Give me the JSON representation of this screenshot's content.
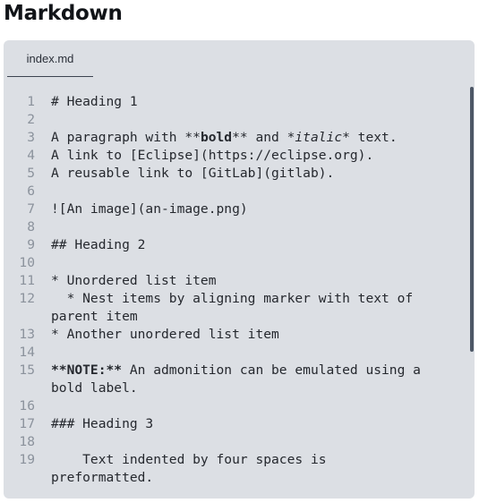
{
  "page": {
    "title": "Markdown"
  },
  "editor": {
    "tab_label": "index.md",
    "lines": [
      {
        "num": "1",
        "text": "# Heading 1"
      },
      {
        "num": "2",
        "text": ""
      },
      {
        "num": "3",
        "parts": [
          {
            "t": "A paragraph with **"
          },
          {
            "t": "bold",
            "style": "bold"
          },
          {
            "t": "** and *"
          },
          {
            "t": "italic",
            "style": "italic"
          },
          {
            "t": "* text."
          }
        ]
      },
      {
        "num": "4",
        "text": "A link to [Eclipse](https://eclipse.org)."
      },
      {
        "num": "5",
        "text": "A reusable link to [GitLab](gitlab)."
      },
      {
        "num": "6",
        "text": ""
      },
      {
        "num": "7",
        "text": "![An image](an-image.png)"
      },
      {
        "num": "8",
        "text": ""
      },
      {
        "num": "9",
        "text": "## Heading 2"
      },
      {
        "num": "10",
        "text": ""
      },
      {
        "num": "11",
        "text": "* Unordered list item"
      },
      {
        "num": "12",
        "text": "  * Nest items by aligning marker with text of"
      },
      {
        "num": "",
        "text": "parent item"
      },
      {
        "num": "13",
        "text": "* Another unordered list item"
      },
      {
        "num": "14",
        "text": ""
      },
      {
        "num": "15",
        "parts": [
          {
            "t": "**NOTE:**",
            "style": "bold"
          },
          {
            "t": " An admonition can be emulated using a"
          }
        ]
      },
      {
        "num": "",
        "text": "bold label."
      },
      {
        "num": "16",
        "text": ""
      },
      {
        "num": "17",
        "text": "### Heading 3"
      },
      {
        "num": "18",
        "text": ""
      },
      {
        "num": "19",
        "text": "    Text indented by four spaces is"
      },
      {
        "num": "",
        "text": "preformatted."
      }
    ]
  }
}
